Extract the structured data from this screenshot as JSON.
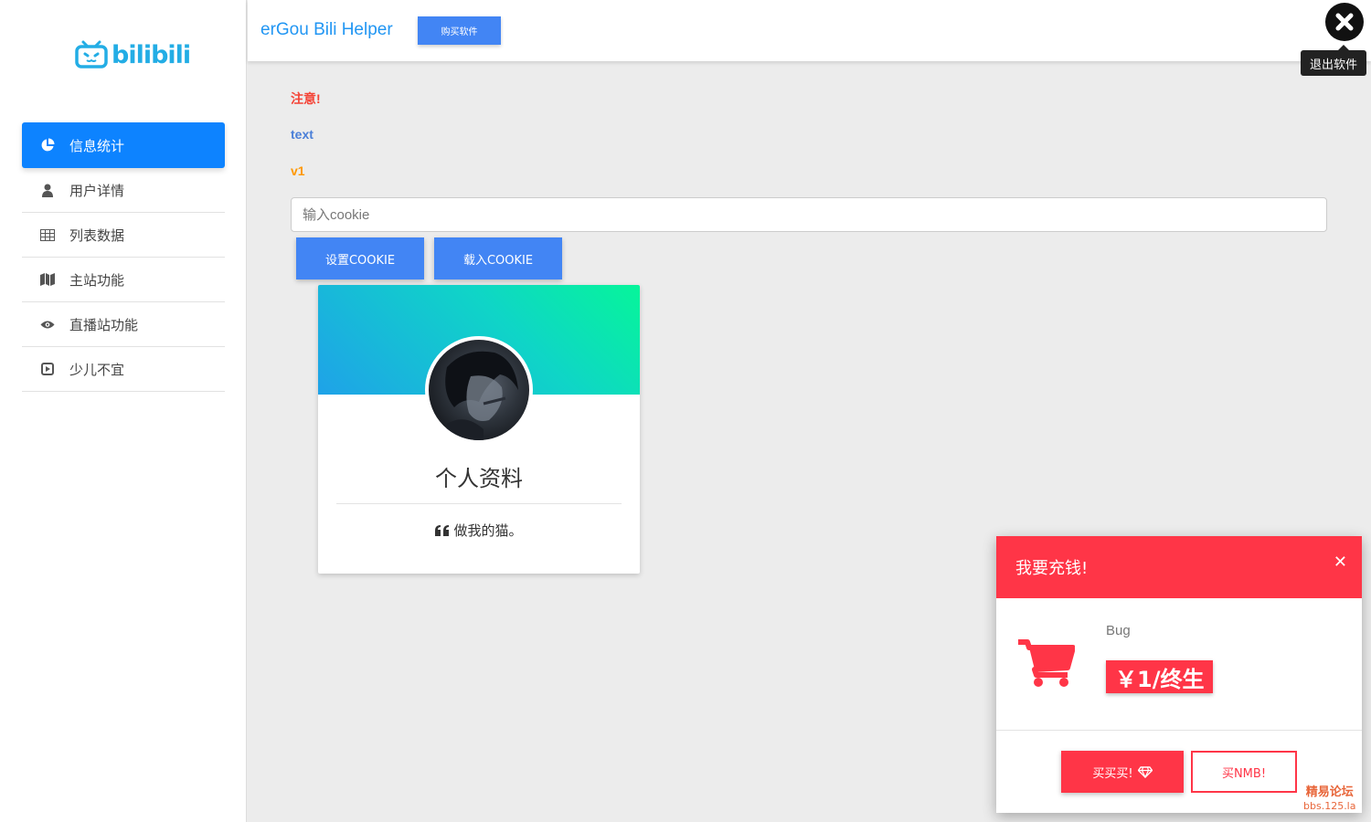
{
  "sidebar": {
    "logo_text": "bilibili",
    "items": [
      {
        "label": "信息统计",
        "icon": "pie-chart-icon"
      },
      {
        "label": "用户详情",
        "icon": "user-icon"
      },
      {
        "label": "列表数据",
        "icon": "table-icon"
      },
      {
        "label": "主站功能",
        "icon": "map-icon"
      },
      {
        "label": "直播站功能",
        "icon": "eye-icon"
      },
      {
        "label": "少儿不宜",
        "icon": "play-square-icon"
      }
    ],
    "active_index": 0
  },
  "header": {
    "title": "erGou Bili Helper",
    "buy_button": "购买软件",
    "exit_tooltip": "退出软件"
  },
  "main": {
    "notice_warning": "注意!",
    "notice_text": "text",
    "notice_version": "v1",
    "cookie_placeholder": "输入cookie",
    "set_cookie_button": "设置COOKIE",
    "load_cookie_button": "载入COOKIE"
  },
  "profile_card": {
    "title": "个人资料",
    "quote": "做我的猫。"
  },
  "recharge_modal": {
    "title": "我要充钱!",
    "product": "Bug",
    "price": "￥1/终生",
    "buy_button": "买买买!",
    "buy_alt_button": "买NMB!"
  },
  "watermark": {
    "line1": "精易论坛",
    "line2": "bbs.125.la"
  },
  "colors": {
    "primary": "#4285f4",
    "active_nav": "#0d83ff",
    "danger": "#ff3547",
    "title_blue": "#2196f3"
  }
}
